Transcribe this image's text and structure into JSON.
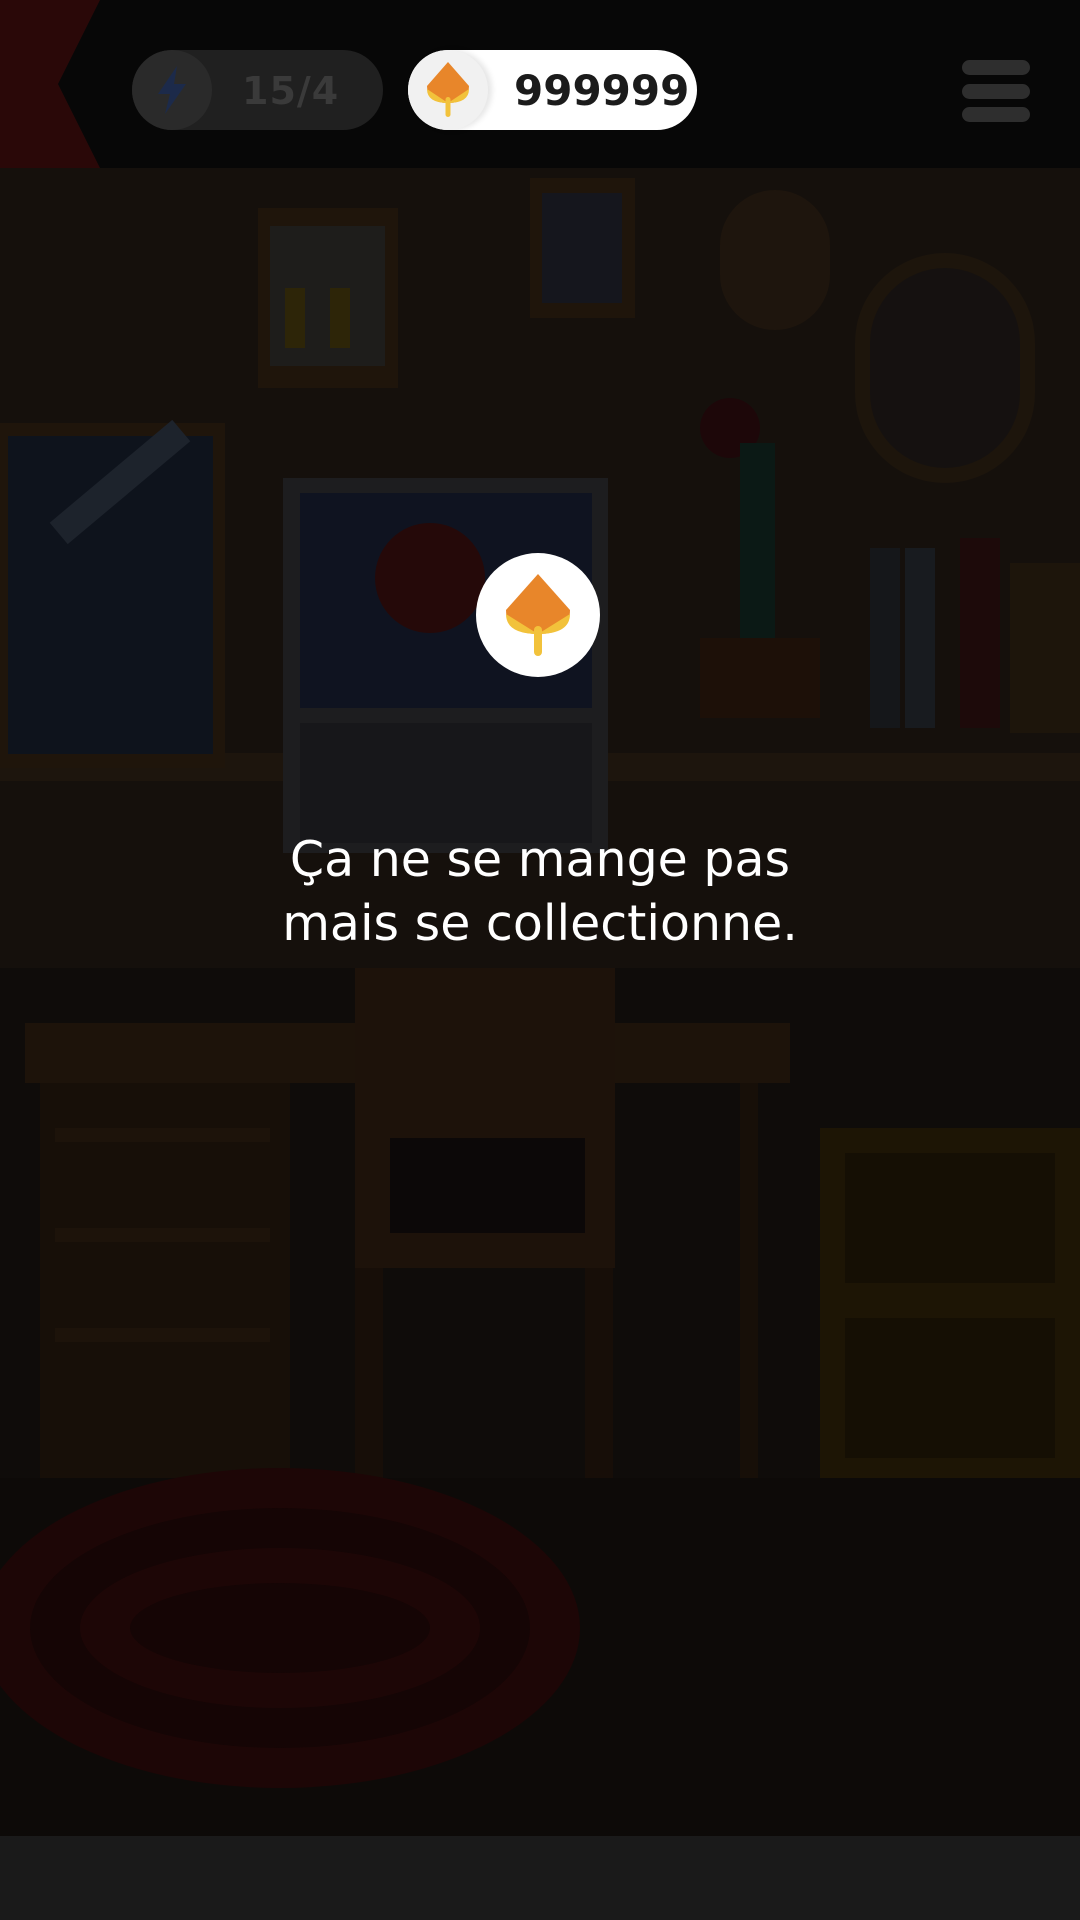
{
  "hud": {
    "energy": {
      "icon": "lightning-bolt-icon",
      "value": "15/4"
    },
    "coins": {
      "icon": "leaf-coin-icon",
      "value": "999999"
    },
    "menu": {
      "icon": "hamburger-menu-icon"
    }
  },
  "toast": {
    "icon": "leaf-coin-icon",
    "line1": "Ça ne se mange pas",
    "line2": "mais se collectionne."
  },
  "colors": {
    "coin_orange": "#e8862a",
    "coin_yellow": "#f2c23b",
    "energy_bolt": "#1c2a4a",
    "overlay_text": "#ffffff"
  }
}
